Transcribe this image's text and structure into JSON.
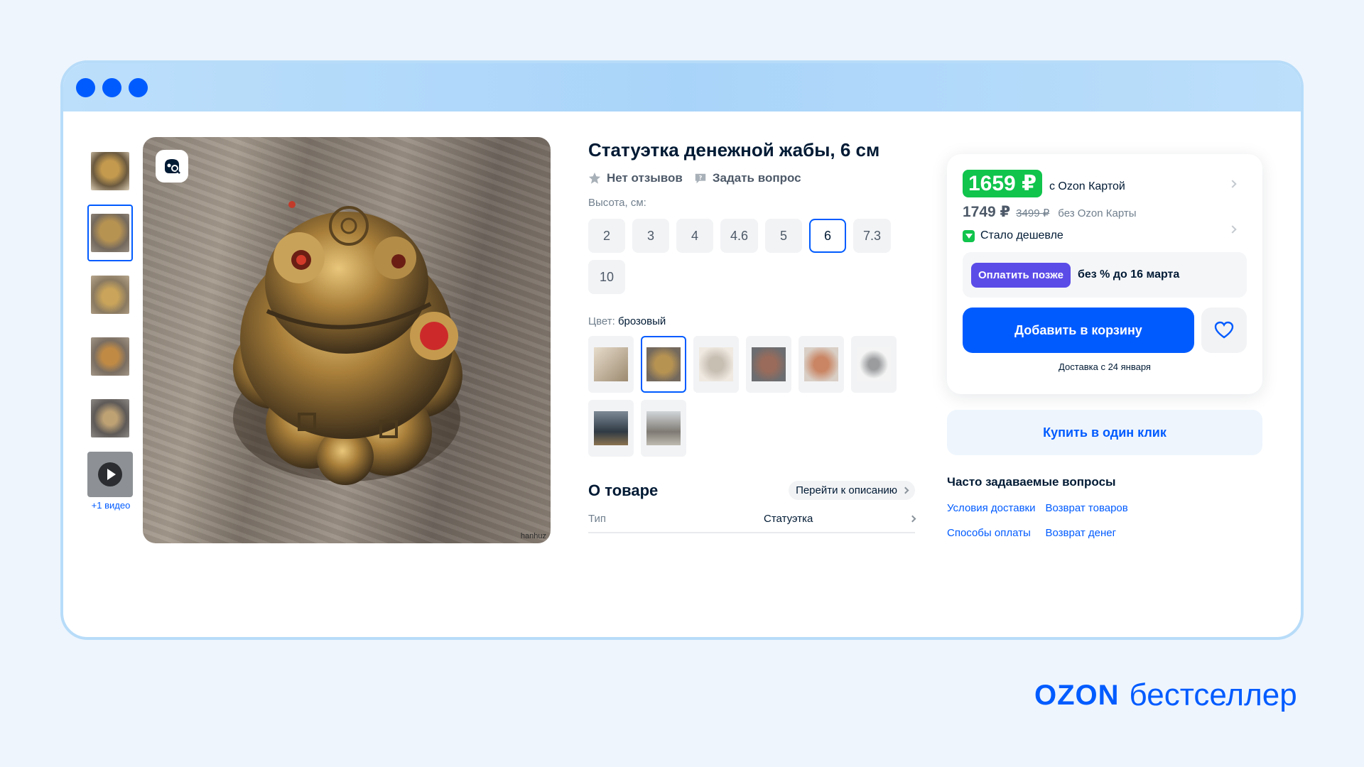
{
  "product": {
    "title": "Статуэтка денежной жабы, 6 см",
    "reviews": "Нет отзывов",
    "ask": "Задать вопрос",
    "height_label": "Высота, см:",
    "sizes": [
      "2",
      "3",
      "4",
      "4.6",
      "5",
      "6",
      "7.3",
      "10"
    ],
    "selected_size": "6",
    "color_label": "Цвет:",
    "color_value": "брозовый",
    "video_label": "+1 видео",
    "watermark": "hanhuz"
  },
  "about": {
    "title": "О товаре",
    "goto": "Перейти к описанию",
    "prop_key": "Тип",
    "prop_value": "Статуэтка"
  },
  "price": {
    "card_price": "1659 ₽",
    "card_caption": "с Ozon Картой",
    "regular_price": "1749 ₽",
    "old_price": "3499 ₽",
    "regular_caption": "без Ozon Карты",
    "cheaper": "Стало дешевле",
    "pay_later_button": "Оплатить позже",
    "pay_later_text": "без % до 16 марта",
    "add_to_cart": "Добавить в корзину",
    "delivery": "Доставка с 24 января",
    "one_click": "Купить в один клик"
  },
  "faq": {
    "title": "Часто задаваемые вопросы",
    "links": [
      "Условия доставки",
      "Возврат товаров",
      "Способы оплаты",
      "Возврат денег"
    ]
  },
  "brand": {
    "ozon": "OZON",
    "tagline": "бестселлер"
  },
  "colors": {
    "accent": "#005bff",
    "green": "#10c44c",
    "purple": "#5b4ce8"
  }
}
